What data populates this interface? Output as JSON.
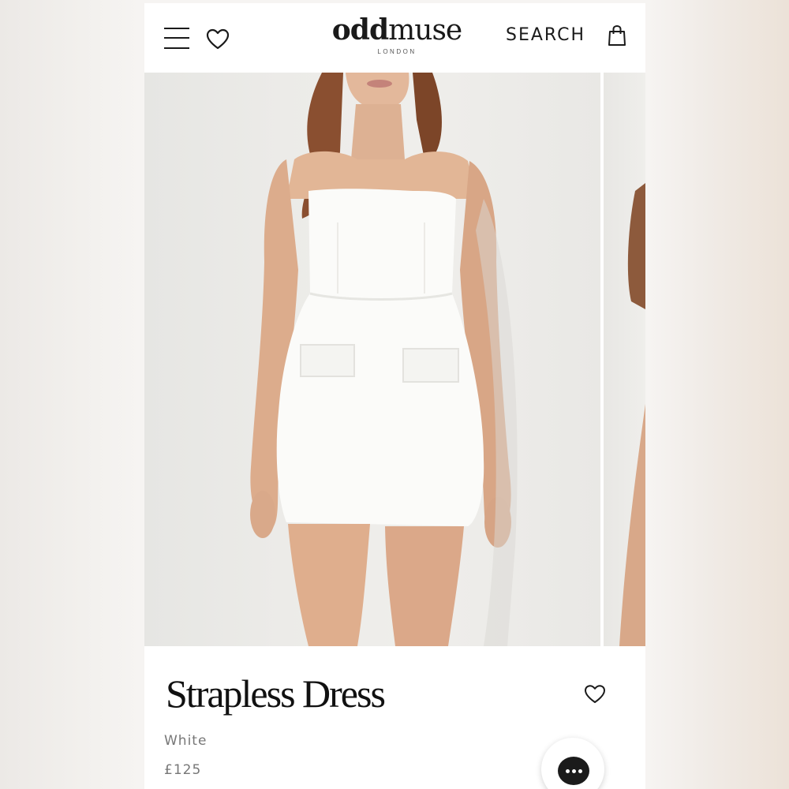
{
  "header": {
    "logo_main_bold": "odd",
    "logo_main_rest": "muse",
    "logo_sub": "LONDON",
    "search_label": "SEARCH",
    "icons": [
      "menu-icon",
      "heart-icon",
      "shopping-bag-icon"
    ]
  },
  "product": {
    "title": "Strapless Dress",
    "color": "White",
    "price": "£125"
  },
  "chat": {
    "icon": "chat-bubble-icon"
  },
  "colors": {
    "background": "#ffffff",
    "text": "#1a1a1a",
    "muted_text": "#777777",
    "chat_button": "#1b1b1b"
  }
}
